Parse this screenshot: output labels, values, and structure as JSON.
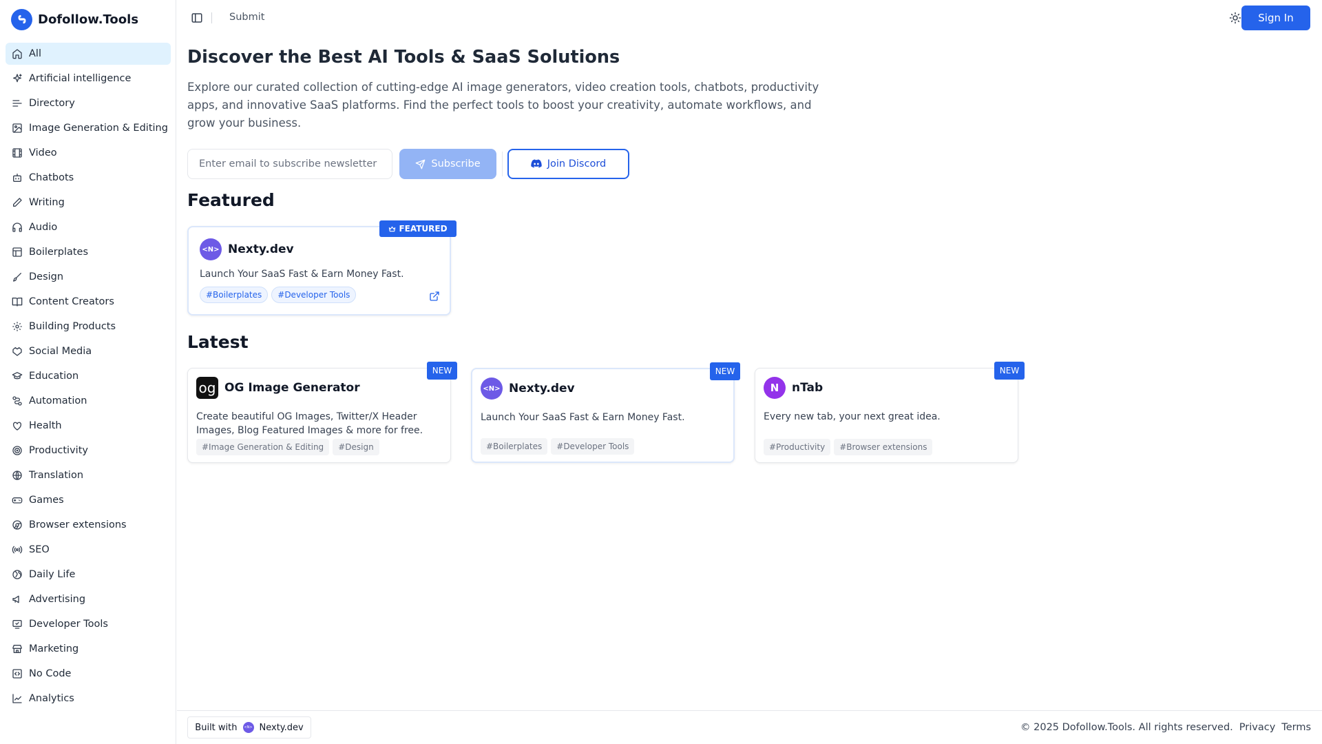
{
  "brand": {
    "name": "Dofollow.Tools"
  },
  "sidebar": {
    "items": [
      {
        "label": "All",
        "icon": "home-icon",
        "active": true
      },
      {
        "label": "Artificial intelligence",
        "icon": "sparkles-icon"
      },
      {
        "label": "Directory",
        "icon": "list-icon"
      },
      {
        "label": "Image Generation & Editing",
        "icon": "image-icon"
      },
      {
        "label": "Video",
        "icon": "film-icon"
      },
      {
        "label": "Chatbots",
        "icon": "bot-icon"
      },
      {
        "label": "Writing",
        "icon": "pen-icon"
      },
      {
        "label": "Audio",
        "icon": "headphones-icon"
      },
      {
        "label": "Boilerplates",
        "icon": "layout-icon"
      },
      {
        "label": "Design",
        "icon": "brush-icon"
      },
      {
        "label": "Content Creators",
        "icon": "book-open-icon"
      },
      {
        "label": "Building Products",
        "icon": "gear-icon"
      },
      {
        "label": "Social Media",
        "icon": "handshake-icon"
      },
      {
        "label": "Education",
        "icon": "graduation-cap-icon"
      },
      {
        "label": "Automation",
        "icon": "workflow-icon"
      },
      {
        "label": "Health",
        "icon": "heart-pulse-icon"
      },
      {
        "label": "Productivity",
        "icon": "target-icon"
      },
      {
        "label": "Translation",
        "icon": "globe-icon"
      },
      {
        "label": "Games",
        "icon": "gamepad-icon"
      },
      {
        "label": "Browser extensions",
        "icon": "chrome-icon"
      },
      {
        "label": "SEO",
        "icon": "radio-icon"
      },
      {
        "label": "Daily Life",
        "icon": "earth-icon"
      },
      {
        "label": "Advertising",
        "icon": "megaphone-icon"
      },
      {
        "label": "Developer Tools",
        "icon": "monitor-check-icon"
      },
      {
        "label": "Marketing",
        "icon": "store-icon"
      },
      {
        "label": "No Code",
        "icon": "square-code-icon"
      },
      {
        "label": "Analytics",
        "icon": "line-chart-icon"
      }
    ]
  },
  "header": {
    "submit_label": "Submit",
    "signin_label": "Sign In"
  },
  "hero": {
    "title": "Discover the Best AI Tools & SaaS Solutions",
    "description": "Explore our curated collection of cutting-edge AI image generators, video creation tools, chatbots, productivity apps, and innovative SaaS platforms. Find the perfect tools to boost your creativity, automate workflows, and grow your business.",
    "email_placeholder": "Enter email to subscribe newsletter",
    "subscribe_label": "Subscribe",
    "discord_label": "Join Discord"
  },
  "featured": {
    "title": "Featured",
    "badge": "FEATURED",
    "card": {
      "logo": "<N>",
      "name": "Nexty.dev",
      "description": "Launch Your SaaS Fast & Earn Money Fast.",
      "tags": [
        "#Boilerplates",
        "#Developer Tools"
      ]
    }
  },
  "latest": {
    "title": "Latest",
    "badge": "NEW",
    "cards": [
      {
        "logo": "og",
        "name": "OG Image Generator",
        "description": "Create beautiful OG Images, Twitter/X Header Images, Blog Featured Images & more for free.",
        "tags": [
          "#Image Generation & Editing",
          "#Design"
        ]
      },
      {
        "logo": "<N>",
        "name": "Nexty.dev",
        "description": "Launch Your SaaS Fast & Earn Money Fast.",
        "tags": [
          "#Boilerplates",
          "#Developer Tools"
        ]
      },
      {
        "logo": "N",
        "name": "nTab",
        "description": "Every new tab, your next great idea.",
        "tags": [
          "#Productivity",
          "#Browser extensions"
        ]
      }
    ]
  },
  "footer": {
    "built_with": "Built with",
    "built_with_brand": "Nexty.dev",
    "built_logo": "<N>",
    "copyright": "© 2025 Dofollow.Tools. All rights reserved.",
    "privacy": "Privacy",
    "terms": "Terms"
  },
  "colors": {
    "accent": "#2563eb",
    "active_nav_bg": "#e0f2fe",
    "subscribe_disabled": "#93b4f5"
  }
}
